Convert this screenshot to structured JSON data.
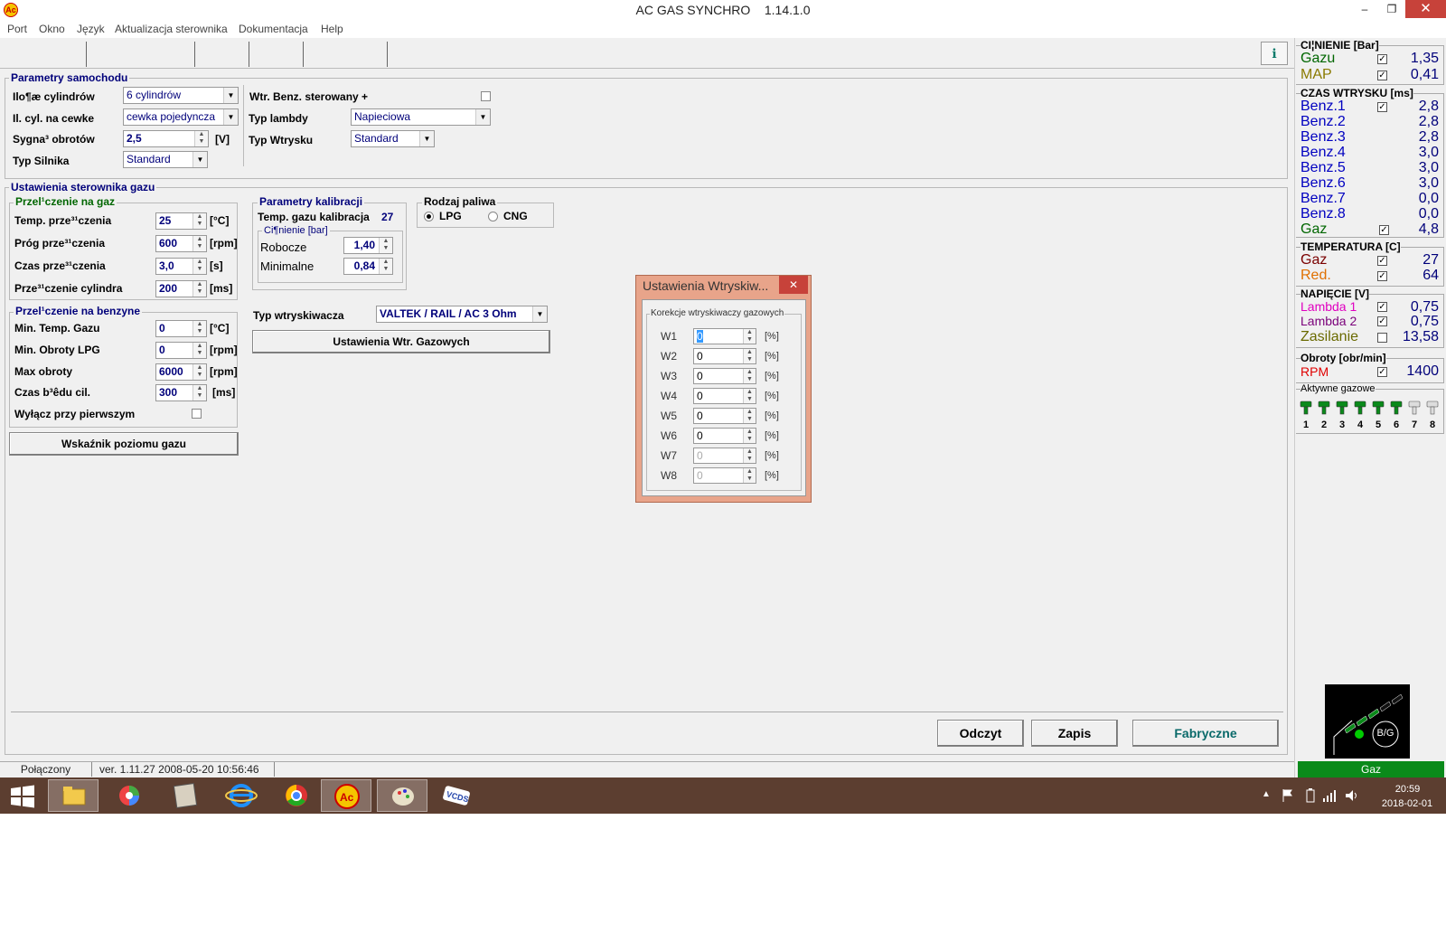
{
  "window": {
    "title": "AC GAS SYNCHRO",
    "version": "1.14.1.0",
    "min": "‒",
    "restore": "❐",
    "close": "✕"
  },
  "menu": [
    "Port",
    "Okno",
    "Język",
    "Aktualizacja sterownika",
    "Dokumentacja",
    "Help"
  ],
  "help_icon": "ℹ",
  "car_params": {
    "title": "Parametry samochodu",
    "cylinders_label": "Ilo¶æ cylindrów",
    "cylinders_value": "6 cylindrów",
    "coil_label": "Il. cyl. na cewke",
    "coil_value": "cewka pojedyncza",
    "rpm_signal_label": "Sygna³ obrotów",
    "rpm_signal_value": "2,5",
    "rpm_signal_unit": "[V]",
    "engine_type_label": "Typ Silnika",
    "engine_type_value": "Standard",
    "benz_ctrl_label": "Wtr. Benz. sterowany +",
    "lambda_type_label": "Typ lambdy",
    "lambda_type_value": "Napieciowa",
    "injection_type_label": "Typ Wtrysku",
    "injection_type_value": "Standard"
  },
  "controller": {
    "title": "Ustawienia sterownika gazu",
    "switch_gas": {
      "title": "Przel¹czenie na gaz",
      "temp_label": "Temp. prze³¹czenia",
      "temp_value": "25",
      "temp_unit": "[°C]",
      "threshold_label": "Próg prze³¹czenia",
      "threshold_value": "600",
      "threshold_unit": "[rpm]",
      "time_label": "Czas prze³¹czenia",
      "time_value": "3,0",
      "time_unit": "[s]",
      "cyl_label": "Prze³¹czenie cylindra",
      "cyl_value": "200",
      "cyl_unit": "[ms]"
    },
    "switch_petrol": {
      "title": "Przel¹czenie na benzyne",
      "min_temp_label": "Min. Temp. Gazu",
      "min_temp_value": "0",
      "min_temp_unit": "[°C]",
      "min_rpm_label": "Min. Obroty LPG",
      "min_rpm_value": "0",
      "min_rpm_unit": "[rpm]",
      "max_rpm_label": "Max obroty",
      "max_rpm_value": "6000",
      "max_rpm_unit": "[rpm]",
      "err_label": "Czas b³êdu cil.",
      "err_value": "300",
      "err_unit": "[ms]",
      "first_off_label": "Wyłącz przy pierwszym"
    },
    "gas_level_button": "Wskaźnik poziomu gazu",
    "calibration": {
      "title": "Parametry kalibracji",
      "temp_label": "Temp. gazu kalibracja",
      "temp_value": "27",
      "pressure_title": "Ci¶nienie [bar]",
      "working_label": "Robocze",
      "working_value": "1,40",
      "min_label": "Minimalne",
      "min_value": "0,84"
    },
    "fuel": {
      "title": "Rodzaj paliwa",
      "lpg": "LPG",
      "cng": "CNG",
      "selected": "LPG"
    },
    "injector_type_label": "Typ wtryskiwacza",
    "injector_type_value": "VALTEK / RAIL / AC 3 Ohm",
    "gas_injectors_button": "Ustawienia Wtr. Gazowych"
  },
  "bottom_buttons": {
    "read": "Odczyt",
    "write": "Zapis",
    "factory": "Fabryczne"
  },
  "dialog": {
    "title": "Ustawienia Wtryskiw...",
    "close": "✕",
    "group_title": "Korekcje wtryskiwaczy gazowych",
    "rows": [
      {
        "label": "W1",
        "value": "0",
        "unit": "[%]"
      },
      {
        "label": "W2",
        "value": "0",
        "unit": "[%]"
      },
      {
        "label": "W3",
        "value": "0",
        "unit": "[%]"
      },
      {
        "label": "W4",
        "value": "0",
        "unit": "[%]"
      },
      {
        "label": "W5",
        "value": "0",
        "unit": "[%]"
      },
      {
        "label": "W6",
        "value": "0",
        "unit": "[%]"
      },
      {
        "label": "W7",
        "value": "0",
        "unit": "[%]"
      },
      {
        "label": "W8",
        "value": "0",
        "unit": "[%]"
      }
    ]
  },
  "status": {
    "connection": "Połączony",
    "version": "ver. 1.11.27  2008-05-20  10:56:46",
    "mode": "Gaz"
  },
  "panel": {
    "pressure": {
      "title": "CI¦NIENIE [Bar]",
      "gas_label": "Gazu",
      "gas_value": "1,35",
      "map_label": "MAP",
      "map_value": "0,41"
    },
    "injection": {
      "title": "CZAS WTRYSKU  [ms]",
      "rows": [
        {
          "label": "Benz.1",
          "value": "2,8"
        },
        {
          "label": "Benz.2",
          "value": "2,8"
        },
        {
          "label": "Benz.3",
          "value": "2,8"
        },
        {
          "label": "Benz.4",
          "value": "3,0"
        },
        {
          "label": "Benz.5",
          "value": "3,0"
        },
        {
          "label": "Benz.6",
          "value": "3,0"
        },
        {
          "label": "Benz.7",
          "value": "0,0"
        },
        {
          "label": "Benz.8",
          "value": "0,0"
        },
        {
          "label": "Gaz",
          "value": "4,8"
        }
      ]
    },
    "temperature": {
      "title": "TEMPERATURA  [C]",
      "gas_label": "Gaz",
      "gas_value": "27",
      "red_label": "Red.",
      "red_value": "64"
    },
    "voltage": {
      "title": "NAPIĘCIE  [V]",
      "l1_label": "Lambda 1",
      "l1_value": "0,75",
      "l2_label": "Lambda 2",
      "l2_value": "0,75",
      "sup_label": "Zasilanie",
      "sup_value": "13,58"
    },
    "rpm": {
      "title": "Obroty [obr/min]",
      "label": "RPM",
      "value": "1400"
    },
    "active": {
      "title": "Aktywne gazowe",
      "numbers": [
        "1",
        "2",
        "3",
        "4",
        "5",
        "6",
        "7",
        "8"
      ]
    },
    "switch_badge": "B/G"
  },
  "taskbar": {
    "time": "20:59",
    "date": "2018-02-01"
  },
  "colors": {
    "accent": "#00007a",
    "green": "#006600",
    "status_green": "#0a8a1a",
    "taskbar": "#5c3e30",
    "dialog_frame": "#e8a48a"
  }
}
